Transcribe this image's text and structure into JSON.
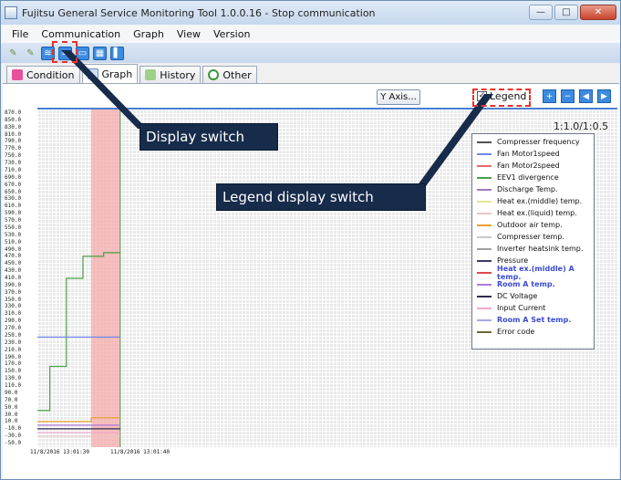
{
  "window": {
    "title": "Fujitsu General Service Monitoring Tool 1.0.0.16 - Stop communication"
  },
  "menu": [
    "File",
    "Communication",
    "Graph",
    "View",
    "Version"
  ],
  "tabs": [
    {
      "label": "Condition"
    },
    {
      "label": "Graph"
    },
    {
      "label": "History"
    },
    {
      "label": "Other"
    }
  ],
  "controls": {
    "y_axis_button": "Y Axis...",
    "legend_checkbox": "Legend",
    "legend_checked": true,
    "ratio": "1:1.0/1:0.5"
  },
  "annotations": {
    "display_switch": "Display switch",
    "legend_display_switch": "Legend display switch"
  },
  "colors": {
    "callout_bg": "#172b4a",
    "highlight_box": "#e8322a",
    "plot_accent": "#4a7fd0",
    "time_marker": "#f4a9a9"
  },
  "legend": [
    {
      "label": "Compresser frequency",
      "color": "#505050"
    },
    {
      "label": "Fan Motor1speed",
      "color": "#6f86e6"
    },
    {
      "label": "Fan Motor2speed",
      "color": "#e46a6a"
    },
    {
      "label": "EEV1 divergence",
      "color": "#4aa04a"
    },
    {
      "label": "Discharge Temp.",
      "color": "#a07ab8"
    },
    {
      "label": "Heat ex.(middle) temp.",
      "color": "#e8e49a"
    },
    {
      "label": "Heat ex.(liquid) temp.",
      "color": "#e6c7c7"
    },
    {
      "label": "Outdoor air temp.",
      "color": "#e6a030"
    },
    {
      "label": "Compresser temp.",
      "color": "#c8c8c8"
    },
    {
      "label": "Inverter heatsink temp.",
      "color": "#a0a0a0"
    },
    {
      "label": "Pressure",
      "color": "#3a3a6a"
    },
    {
      "label": "Heat ex.(middle) A temp.",
      "color": "#e04a4a"
    },
    {
      "label": "Room A temp.",
      "color": "#b07ad8"
    },
    {
      "label": "DC Voltage",
      "color": "#2a2a50"
    },
    {
      "label": "Input Current",
      "color": "#f0a8c8"
    },
    {
      "label": "Room A Set temp.",
      "color": "#a8a8e8"
    },
    {
      "label": "Error code",
      "color": "#6a6a30"
    }
  ],
  "chart_data": {
    "type": "line",
    "y_ticks": [
      "870.0",
      "850.0",
      "830.0",
      "810.0",
      "790.0",
      "770.0",
      "750.0",
      "730.0",
      "710.0",
      "690.0",
      "670.0",
      "650.0",
      "630.0",
      "610.0",
      "590.0",
      "570.0",
      "550.0",
      "530.0",
      "510.0",
      "490.0",
      "470.0",
      "450.0",
      "430.0",
      "410.0",
      "390.0",
      "370.0",
      "350.0",
      "330.0",
      "310.0",
      "290.0",
      "270.0",
      "250.0",
      "230.0",
      "210.0",
      "190.0",
      "170.0",
      "150.0",
      "130.0",
      "110.0",
      "90.0",
      "70.0",
      "50.0",
      "30.0",
      "10.0",
      "-10.0",
      "-30.0",
      "-50.0"
    ],
    "x_labels": [
      "11/8/2016 13:01:30",
      "11/8/2016 13:01:40"
    ],
    "ylim": [
      -50,
      870
    ],
    "grid": true,
    "series": [
      {
        "name": "EEV1 divergence",
        "color": "#4aa04a",
        "points": [
          [
            0,
            50
          ],
          [
            3,
            50
          ],
          [
            3,
            170
          ],
          [
            7,
            170
          ],
          [
            7,
            410
          ],
          [
            11,
            410
          ],
          [
            11,
            470
          ],
          [
            16,
            470
          ],
          [
            16,
            480
          ],
          [
            20,
            480
          ]
        ]
      },
      {
        "name": "Fan Motor1speed",
        "color": "#6f86e6",
        "points": [
          [
            0,
            250
          ],
          [
            20,
            250
          ]
        ]
      },
      {
        "name": "Outdoor air temp.",
        "color": "#e6a030",
        "points": [
          [
            0,
            20
          ],
          [
            13,
            20
          ],
          [
            13,
            30
          ],
          [
            20,
            30
          ]
        ]
      },
      {
        "name": "Room A temp.",
        "color": "#b07ad8",
        "points": [
          [
            0,
            10
          ],
          [
            20,
            10
          ]
        ]
      },
      {
        "name": "DC Voltage",
        "color": "#2a2a50",
        "points": [
          [
            0,
            0
          ],
          [
            20,
            0
          ]
        ]
      },
      {
        "name": "Input Current",
        "color": "#f0a8c8",
        "points": [
          [
            0,
            -10
          ],
          [
            20,
            -10
          ]
        ]
      },
      {
        "name": "Heat ex.(liquid) temp.",
        "color": "#e6c7c7",
        "points": [
          [
            0,
            -20
          ],
          [
            20,
            -20
          ]
        ]
      }
    ],
    "x_range": [
      0,
      140
    ],
    "marker_range": [
      13,
      20
    ]
  }
}
